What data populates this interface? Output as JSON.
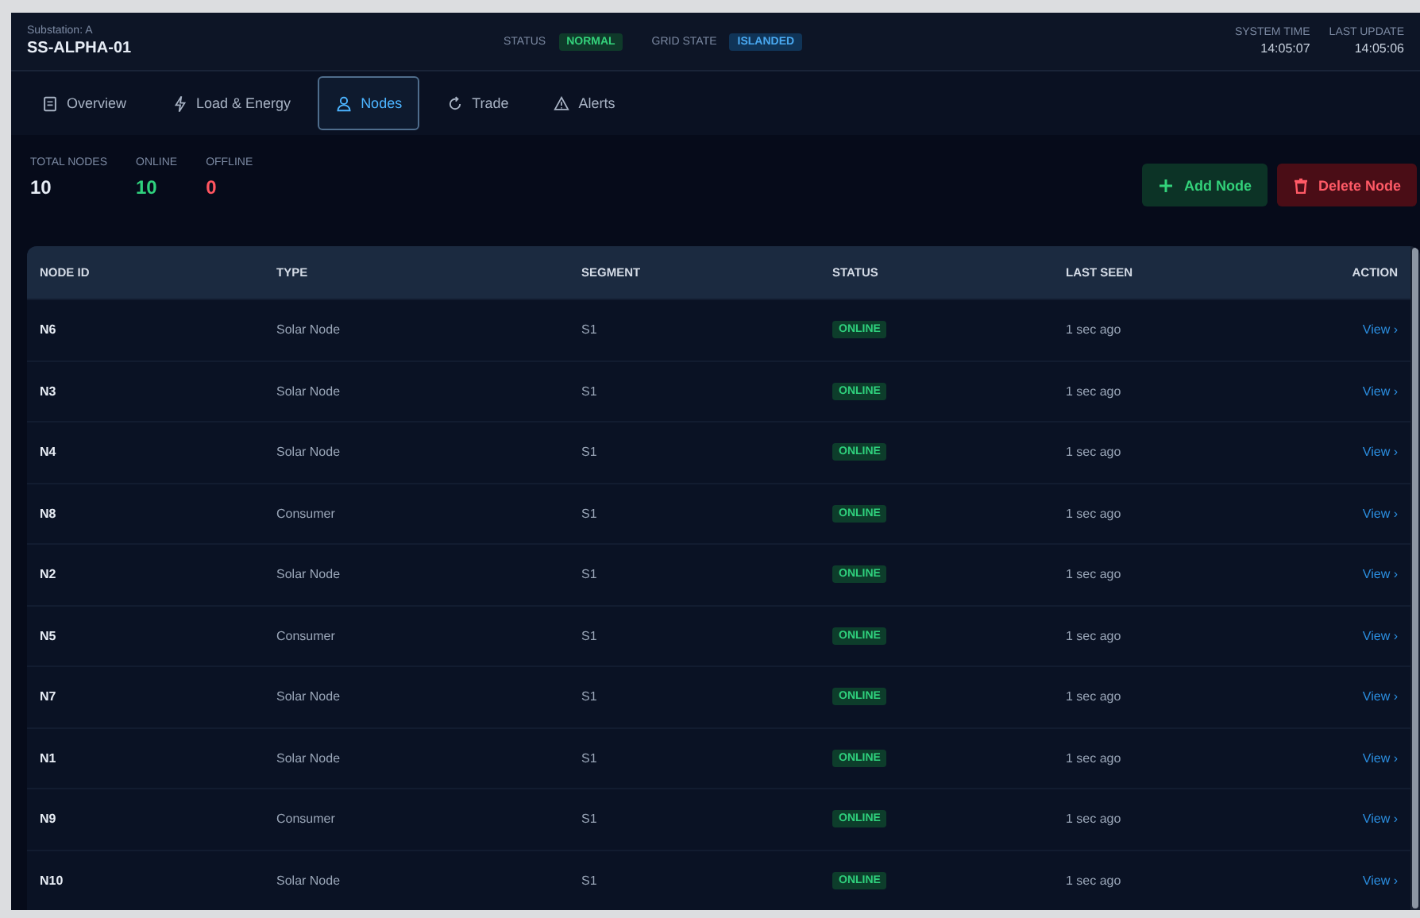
{
  "header": {
    "site_label": "Substation: A",
    "site_name": "SS-ALPHA-01",
    "status_label": "STATUS",
    "status_value": "NORMAL",
    "grid_label": "GRID STATE",
    "grid_value": "ISLANDED",
    "clocks": [
      {
        "label": "SYSTEM TIME",
        "value": "14:05:07"
      },
      {
        "label": "LAST UPDATE",
        "value": "14:05:06"
      }
    ]
  },
  "tabs": [
    {
      "label": "Overview",
      "selected": false
    },
    {
      "label": "Load & Energy",
      "selected": false
    },
    {
      "label": "Nodes",
      "selected": true
    },
    {
      "label": "Trade",
      "selected": false
    },
    {
      "label": "Alerts",
      "selected": false
    }
  ],
  "stats": [
    {
      "label": "TOTAL NODES",
      "value": "10",
      "kind": "total"
    },
    {
      "label": "ONLINE",
      "value": "10",
      "kind": "online"
    },
    {
      "label": "OFFLINE",
      "value": "0",
      "kind": "offline"
    }
  ],
  "buttons": [
    {
      "label": "Add Node",
      "kind": "add"
    },
    {
      "label": "Delete Node",
      "kind": "delete"
    }
  ],
  "table": {
    "columns": [
      "NODE ID",
      "TYPE",
      "SEGMENT",
      "STATUS",
      "LAST SEEN",
      "ACTION"
    ],
    "rows": [
      {
        "id": "N6",
        "type": "Solar Node",
        "segment": "S1",
        "status": "ONLINE",
        "last_seen": "1 sec ago",
        "action": "View ›"
      },
      {
        "id": "N3",
        "type": "Solar Node",
        "segment": "S1",
        "status": "ONLINE",
        "last_seen": "1 sec ago",
        "action": "View ›"
      },
      {
        "id": "N4",
        "type": "Solar Node",
        "segment": "S1",
        "status": "ONLINE",
        "last_seen": "1 sec ago",
        "action": "View ›"
      },
      {
        "id": "N8",
        "type": "Consumer",
        "segment": "S1",
        "status": "ONLINE",
        "last_seen": "1 sec ago",
        "action": "View ›"
      },
      {
        "id": "N2",
        "type": "Solar Node",
        "segment": "S1",
        "status": "ONLINE",
        "last_seen": "1 sec ago",
        "action": "View ›"
      },
      {
        "id": "N5",
        "type": "Consumer",
        "segment": "S1",
        "status": "ONLINE",
        "last_seen": "1 sec ago",
        "action": "View ›"
      },
      {
        "id": "N7",
        "type": "Solar Node",
        "segment": "S1",
        "status": "ONLINE",
        "last_seen": "1 sec ago",
        "action": "View ›"
      },
      {
        "id": "N1",
        "type": "Solar Node",
        "segment": "S1",
        "status": "ONLINE",
        "last_seen": "1 sec ago",
        "action": "View ›"
      },
      {
        "id": "N9",
        "type": "Consumer",
        "segment": "S1",
        "status": "ONLINE",
        "last_seen": "1 sec ago",
        "action": "View ›"
      },
      {
        "id": "N10",
        "type": "Solar Node",
        "segment": "S1",
        "status": "ONLINE",
        "last_seen": "1 sec ago",
        "action": "View ›"
      }
    ]
  }
}
